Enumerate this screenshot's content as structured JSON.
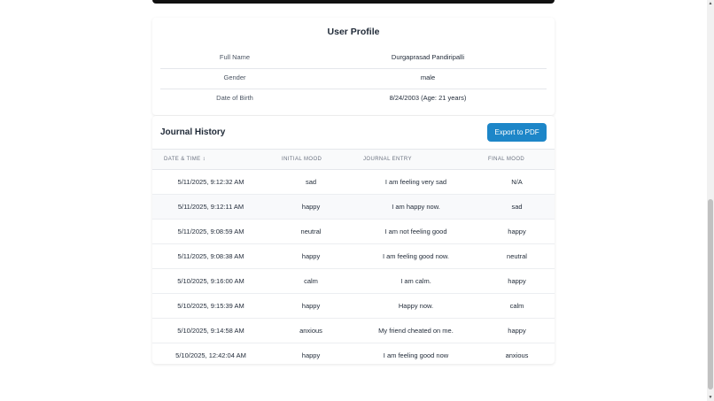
{
  "profile": {
    "title": "User Profile",
    "rows": [
      {
        "label": "Full Name",
        "value": "Durgaprasad Pandiripalli"
      },
      {
        "label": "Gender",
        "value": "male"
      },
      {
        "label": "Date of Birth",
        "value": "8/24/2003 (Age: 21 years)"
      }
    ]
  },
  "journal": {
    "title": "Journal History",
    "export_label": "Export to PDF",
    "columns": {
      "date": "Date & Time ↕",
      "initial": "Initial Mood",
      "entry": "Journal Entry",
      "final": "Final Mood"
    },
    "rows": [
      {
        "date": "5/11/2025, 9:12:32 AM",
        "initial": "sad",
        "entry": "I am feeling very sad",
        "final": "N/A"
      },
      {
        "date": "5/11/2025, 9:12:11 AM",
        "initial": "happy",
        "entry": "I am happy now.",
        "final": "sad"
      },
      {
        "date": "5/11/2025, 9:08:59 AM",
        "initial": "neutral",
        "entry": "I am not feeling good",
        "final": "happy"
      },
      {
        "date": "5/11/2025, 9:08:38 AM",
        "initial": "happy",
        "entry": "I am feeling good now.",
        "final": "neutral"
      },
      {
        "date": "5/10/2025, 9:16:00 AM",
        "initial": "calm",
        "entry": "I am calm.",
        "final": "happy"
      },
      {
        "date": "5/10/2025, 9:15:39 AM",
        "initial": "happy",
        "entry": "Happy now.",
        "final": "calm"
      },
      {
        "date": "5/10/2025, 9:14:58 AM",
        "initial": "anxious",
        "entry": "My friend cheated on me.",
        "final": "happy"
      },
      {
        "date": "5/10/2025, 12:42:04 AM",
        "initial": "happy",
        "entry": "I am feeling good now",
        "final": "anxious"
      }
    ]
  },
  "scrollbar": {
    "up_icon": "scroll-up-arrow-icon",
    "down_icon": "scroll-down-arrow-icon"
  },
  "colors": {
    "accent": "#1d86c8"
  }
}
